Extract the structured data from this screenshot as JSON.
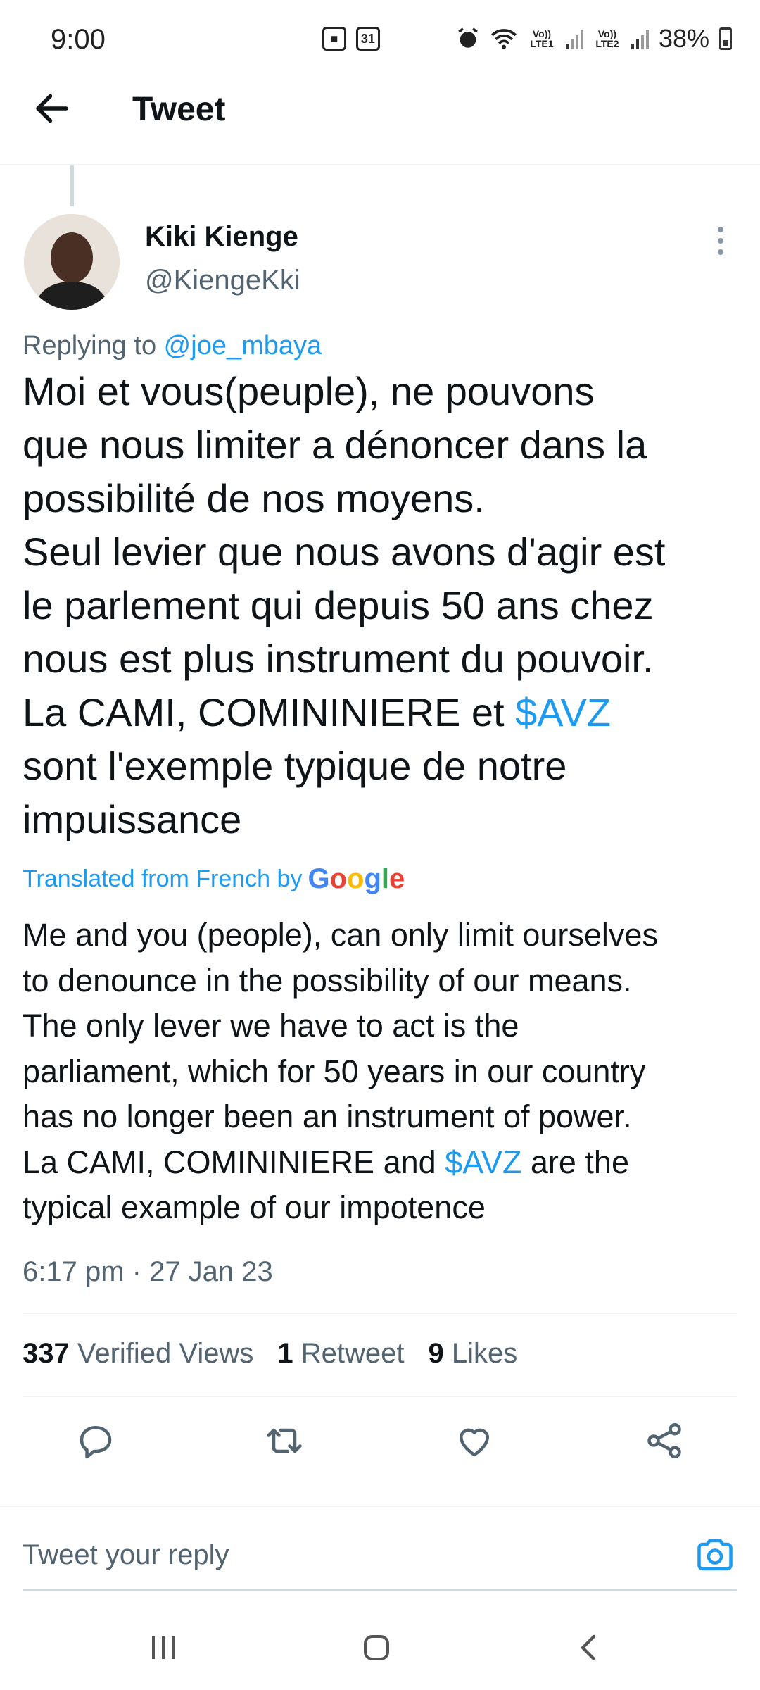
{
  "status_bar": {
    "time": "9:00",
    "calendar_day": "31",
    "lte1": "Vo)) LTE1",
    "lte2": "Vo)) LTE2",
    "battery": "38%"
  },
  "header": {
    "title": "Tweet"
  },
  "tweet": {
    "author_name": "Kiki Kienge",
    "author_handle": "@KiengeKki",
    "replying_prefix": "Replying to ",
    "replying_handle": "@joe_mbaya",
    "text_before_link": "Moi et vous(peuple), ne pouvons\nque nous limiter a dénoncer dans la\npossibilité de nos moyens.\nSeul levier que nous avons d'agir est\nle parlement qui depuis 50 ans chez\nnous est plus instrument du pouvoir.\nLa CAMI, COMININIERE et ",
    "text_link": "$AVZ",
    "text_after_link": "\nsont l'exemple typique de notre\nimpuissance",
    "translated_label": "Translated from French by",
    "google_label": "Google",
    "translation_before_link": "Me and you (people), can only limit ourselves\nto denounce in the possibility of our means.\nThe only lever we have to act is the\nparliament, which for 50 years in our country\nhas no longer been an instrument of power.\nLa CAMI, COMININIERE and ",
    "translation_link": "$AVZ",
    "translation_after_link": " are the\ntypical example of our impotence",
    "timestamp": "6:17 pm · 27 Jan 23",
    "stats": {
      "views_count": "337",
      "views_label": "Verified Views",
      "retweets_count": "1",
      "retweets_label": "Retweet",
      "likes_count": "9",
      "likes_label": "Likes"
    }
  },
  "actions": [
    "reply-icon",
    "retweet-icon",
    "like-icon",
    "share-icon"
  ],
  "reply_box": {
    "placeholder": "Tweet your reply"
  },
  "colors": {
    "accent": "#1d9bf0",
    "text": "#0f1419",
    "muted": "#536471"
  }
}
